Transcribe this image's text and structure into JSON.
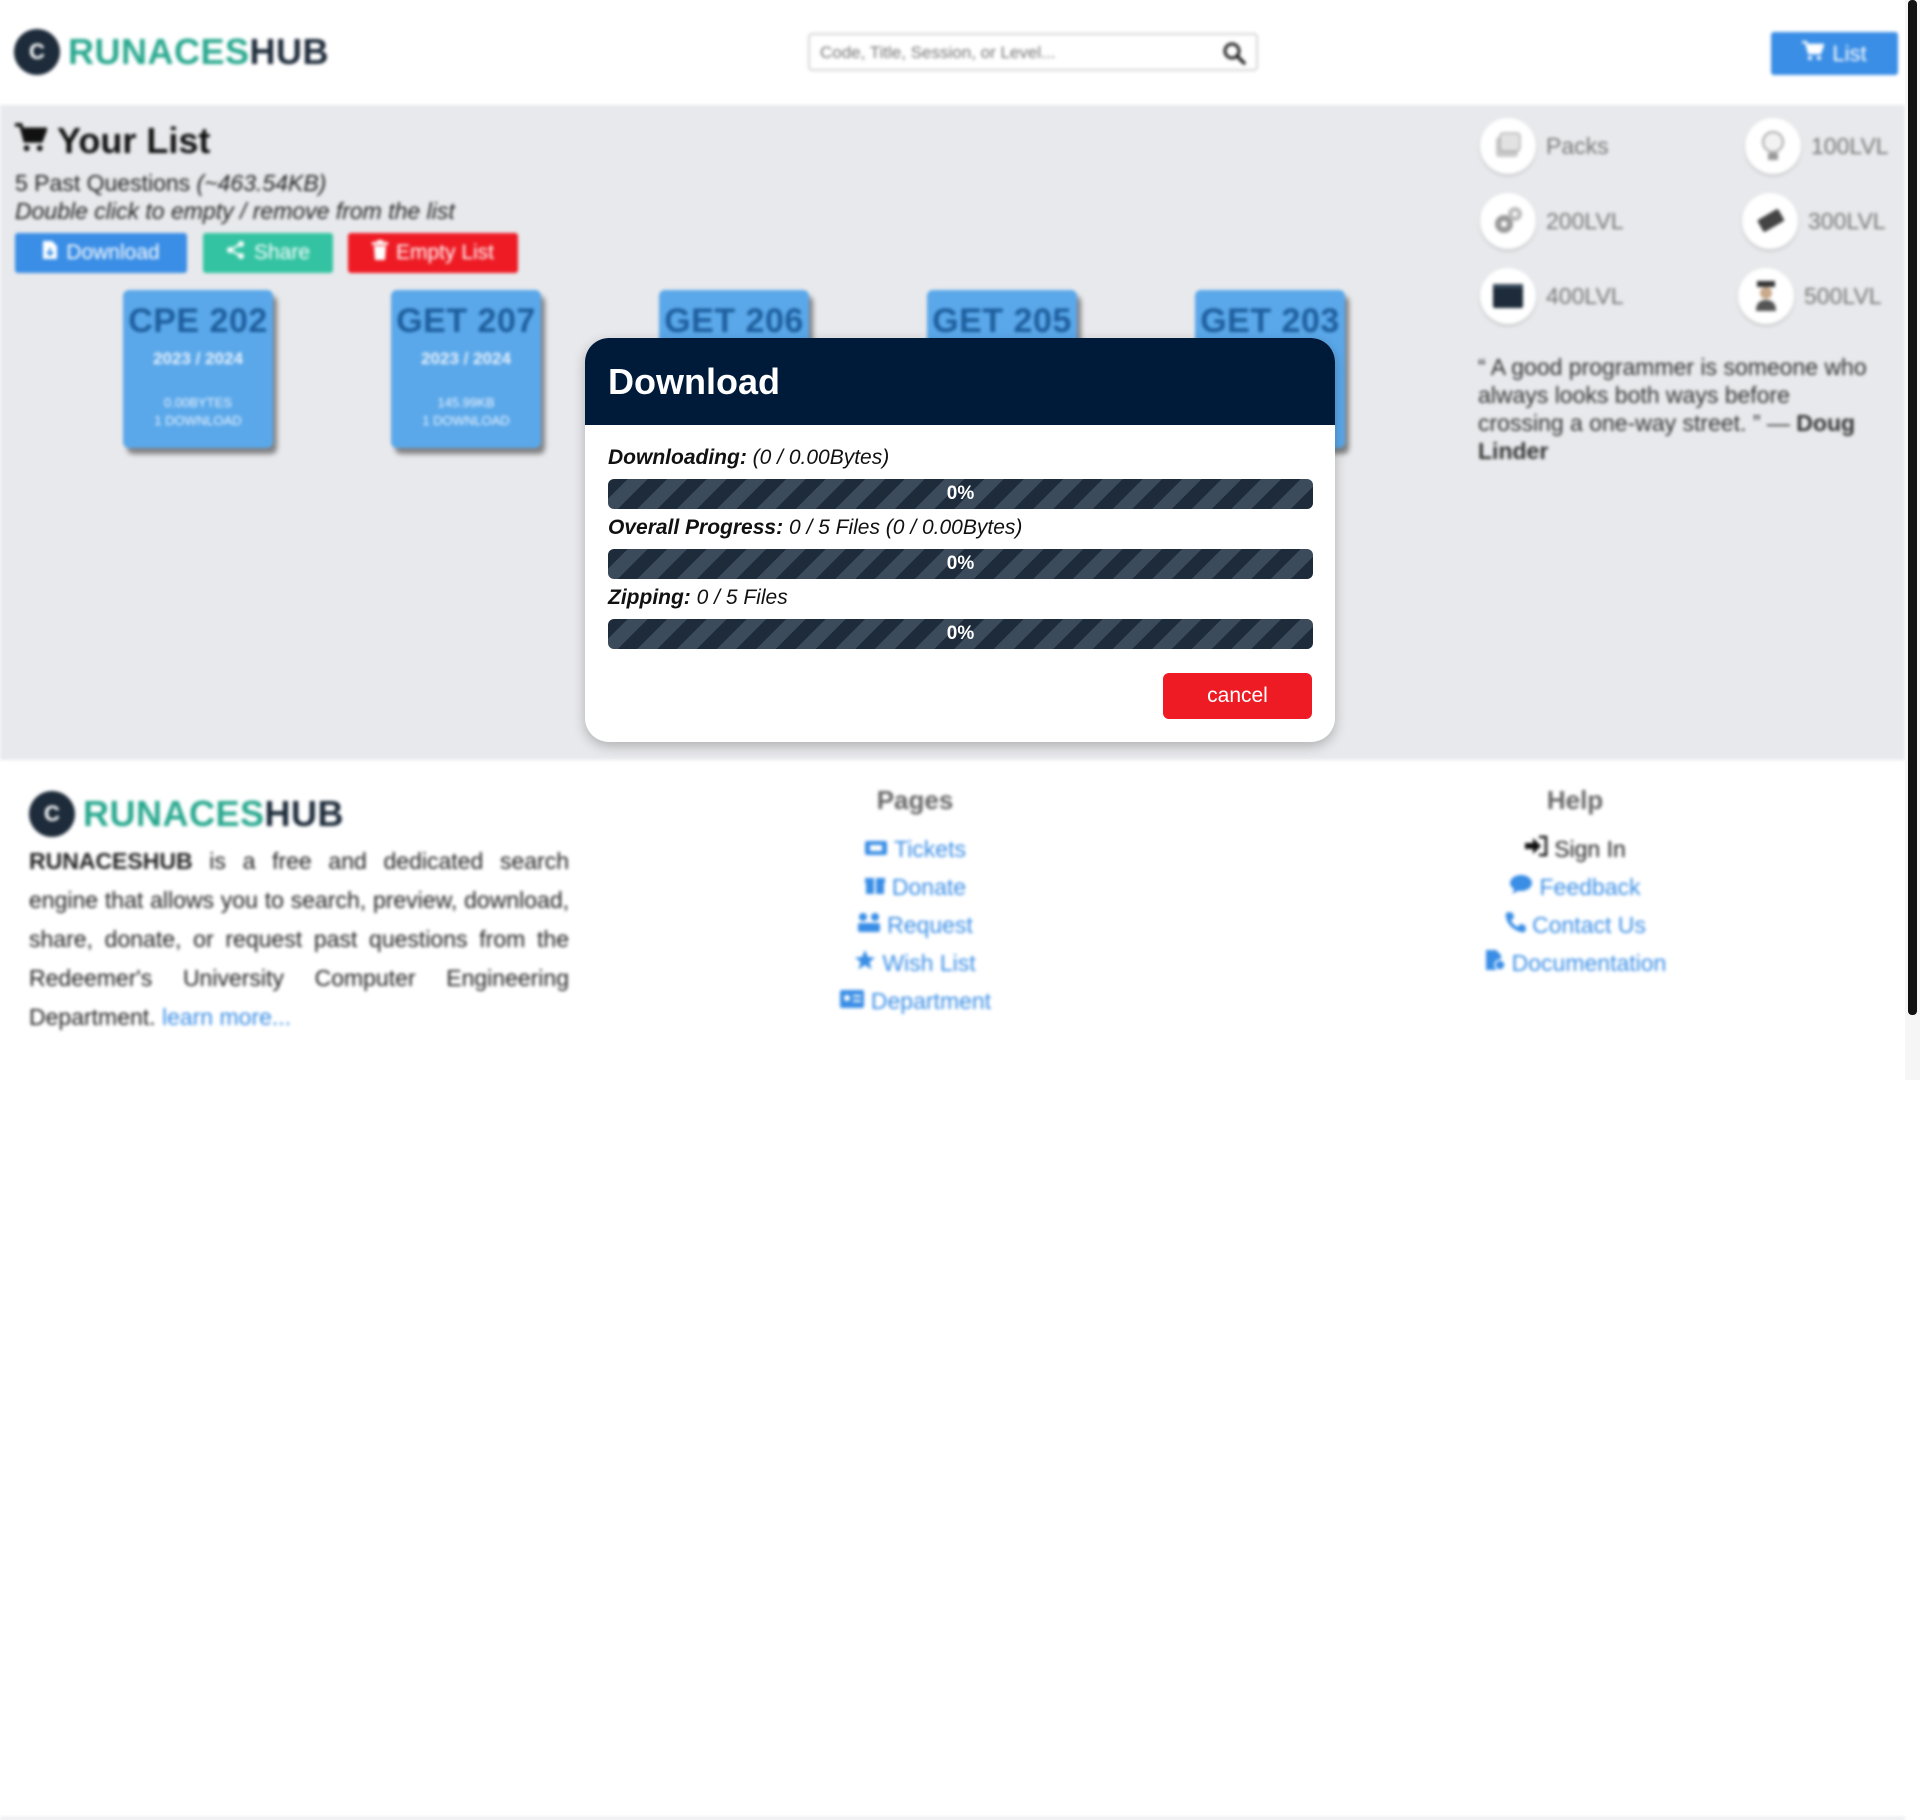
{
  "header": {
    "logo_part1": "RUNACES",
    "logo_part2": "HUB",
    "search_placeholder": "Code, Title, Session, or Level...",
    "list_button_label": "List"
  },
  "list": {
    "title": "Your List",
    "summary_count": "5 Past Questions",
    "summary_size": "(~463.54KB)",
    "hint": "Double click to empty / remove from the list",
    "download_label": "Download",
    "share_label": "Share",
    "empty_label": "Empty List"
  },
  "cards": [
    {
      "code": "CPE 202",
      "session": "2023 / 2024",
      "size": "0.00BYTES",
      "downloads": "1 DOWNLOAD"
    },
    {
      "code": "GET 207",
      "session": "2023 / 2024",
      "size": "145.99KB",
      "downloads": "1 DOWNLOAD"
    },
    {
      "code": "GET 206",
      "session": "",
      "size": "",
      "downloads": ""
    },
    {
      "code": "GET 205",
      "session": "",
      "size": "",
      "downloads": ""
    },
    {
      "code": "GET 203",
      "session": "",
      "size": "",
      "downloads": ""
    }
  ],
  "levels": [
    {
      "label": "Packs",
      "icon": "packs-icon"
    },
    {
      "label": "100LVL",
      "icon": "lightbulb-icon"
    },
    {
      "label": "200LVL",
      "icon": "gears-icon"
    },
    {
      "label": "300LVL",
      "icon": "chip-icon"
    },
    {
      "label": "400LVL",
      "icon": "terminal-icon"
    },
    {
      "label": "500LVL",
      "icon": "graduate-icon"
    }
  ],
  "quote": {
    "text": "“ A good programmer is someone who always looks both ways before crossing a one-way street. ” — ",
    "author": "Doug Linder"
  },
  "footer": {
    "logo_part1": "RUNACES",
    "logo_part2": "HUB",
    "about_brand": "RUNACESHUB",
    "about_text": " is a free and dedicated search engine that allows you to search, preview, download, share, donate, or request past questions from the Redeemer's University Computer Engineering Department. ",
    "learn_more": "learn more...",
    "pages_title": "Pages",
    "pages": [
      "Tickets",
      "Donate",
      "Request",
      "Wish List",
      "Department"
    ],
    "help_title": "Help",
    "help": [
      "Sign In",
      "Feedback",
      "Contact Us",
      "Documentation"
    ]
  },
  "modal": {
    "title": "Download",
    "downloading_label": "Downloading:",
    "downloading_value": "(0 / 0.00Bytes)",
    "downloading_progress": 0,
    "downloading_pct": "0%",
    "overall_label": "Overall Progress:",
    "overall_value": "0 / 5 Files (0 / 0.00Bytes)",
    "overall_progress": 0,
    "overall_pct": "0%",
    "zipping_label": "Zipping:",
    "zipping_value": "0 / 5 Files",
    "zipping_progress": 0,
    "zipping_pct": "0%",
    "cancel_label": "cancel"
  },
  "colors": {
    "brand_teal": "#2aa98f",
    "brand_navy": "#1d2b3a",
    "primary_blue": "#3a8ee6",
    "share_green": "#33c3a2",
    "danger_red": "#ee1b24",
    "modal_header": "#001a3a"
  }
}
